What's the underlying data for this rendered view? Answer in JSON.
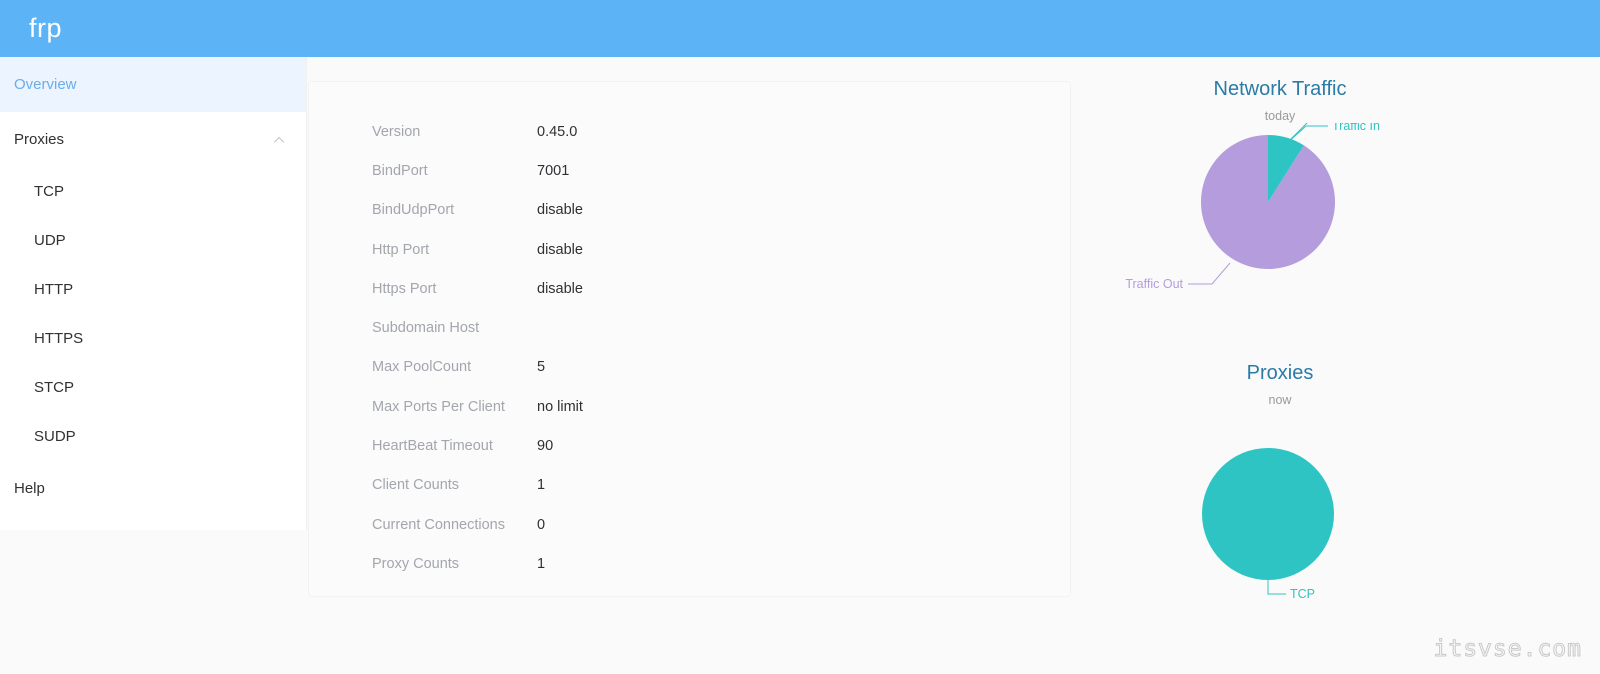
{
  "header": {
    "brand": "frp"
  },
  "sidebar": {
    "overview": {
      "label": "Overview"
    },
    "proxies_group": {
      "label": "Proxies",
      "chevron_icon": "chevron-up-icon"
    },
    "proxy_items": [
      {
        "label": "TCP"
      },
      {
        "label": "UDP"
      },
      {
        "label": "HTTP"
      },
      {
        "label": "HTTPS"
      },
      {
        "label": "STCP"
      },
      {
        "label": "SUDP"
      }
    ],
    "help": {
      "label": "Help"
    }
  },
  "main": {
    "rows": [
      {
        "key": "Version",
        "value": "0.45.0"
      },
      {
        "key": "BindPort",
        "value": "7001"
      },
      {
        "key": "BindUdpPort",
        "value": "disable"
      },
      {
        "key": "Http Port",
        "value": "disable"
      },
      {
        "key": "Https Port",
        "value": "disable"
      },
      {
        "key": "Subdomain Host",
        "value": ""
      },
      {
        "key": "Max PoolCount",
        "value": "5"
      },
      {
        "key": "Max Ports Per Client",
        "value": "no limit"
      },
      {
        "key": "HeartBeat Timeout",
        "value": "90"
      },
      {
        "key": "Client Counts",
        "value": "1"
      },
      {
        "key": "Current Connections",
        "value": "0"
      },
      {
        "key": "Proxy Counts",
        "value": "1"
      }
    ]
  },
  "charts": [
    {
      "title": "Network Traffic",
      "subtitle": "today",
      "labels": {
        "in": "Traffic In",
        "out": "Traffic Out"
      }
    },
    {
      "title": "Proxies",
      "subtitle": "now",
      "labels": {
        "tcp": "TCP"
      }
    }
  ],
  "chart_data": [
    {
      "type": "pie",
      "title": "Network Traffic",
      "subtitle": "today",
      "categories": [
        "Traffic In",
        "Traffic Out"
      ],
      "values": [
        9,
        91
      ],
      "unit": "percent",
      "colors": [
        "#2fc4c4",
        "#b49cdd"
      ],
      "legend": "labels-outside",
      "start_angle_deg": 0
    },
    {
      "type": "pie",
      "title": "Proxies",
      "subtitle": "now",
      "categories": [
        "TCP"
      ],
      "values": [
        1
      ],
      "unit": "count",
      "colors": [
        "#2fc4c4"
      ],
      "legend": "labels-outside",
      "start_angle_deg": 0
    }
  ],
  "colors": {
    "header_bg": "#5cb3f5",
    "accent_blue": "#409eff",
    "active_bg": "#ecf5ff",
    "teal": "#2fc4c4",
    "purple": "#b49cdd",
    "chart_title": "#2a7ba6",
    "page_bg": "#fafafa"
  },
  "watermark": {
    "text": "itsvse.com"
  }
}
